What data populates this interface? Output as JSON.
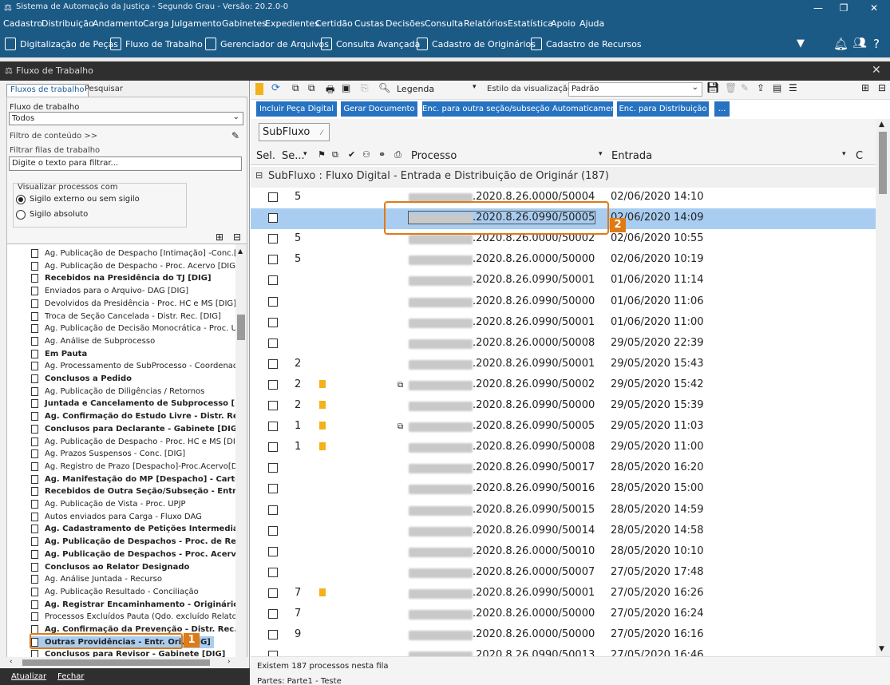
{
  "app": {
    "title": "Sistema de Automação da Justiça - Segundo Grau - Versão: 20.2.0-0",
    "min_icon": "—",
    "restore_icon": "❐",
    "close_icon": "✕"
  },
  "menu": [
    "Cadastro",
    "Distribuição",
    "Andamento",
    "Carga",
    "Julgamento",
    "Gabinetes",
    "Expedientes",
    "Certidão",
    "Custas",
    "Decisões",
    "Consulta",
    "Relatórios",
    "Estatística",
    "Apoio",
    "Ajuda"
  ],
  "toolbar": [
    "Digitalização de Peças",
    "Fluxo de Trabalho",
    "Gerenciador de Arquivos",
    "Consulta Avançada",
    "Cadastro de Originários",
    "Cadastro de Recursos"
  ],
  "panel": {
    "title": "Fluxo de Trabalho",
    "close": "✕"
  },
  "left": {
    "tabs": [
      "Fluxos de trabalho",
      "Pesquisar"
    ],
    "fluxo_label": "Fluxo de trabalho",
    "fluxo_value": "Todos",
    "filtro_conteudo": "Filtro de conteúdo >>",
    "filtrar_label": "Filtrar filas de trabalho",
    "filtrar_placeholder": "Digite o texto para filtrar...",
    "visualizar_label": "Visualizar processos com",
    "radio1": "Sigilo externo ou sem sigilo",
    "radio2": "Sigilo absoluto",
    "tree": [
      {
        "label": "Ag. Publicação de Despacho [Intimação] -Conc.[DIG]",
        "bold": false
      },
      {
        "label": "Ag. Publicação de Despacho - Proc. Acervo [DIG]",
        "bold": false
      },
      {
        "label": "Recebidos na Presidência do TJ [DIG]",
        "bold": true
      },
      {
        "label": "Enviados para o Arquivo- DAG [DIG]",
        "bold": false
      },
      {
        "label": "Devolvidos da Presidência - Proc. HC e MS [DIG]",
        "bold": false
      },
      {
        "label": "Troca de Seção Cancelada - Distr. Rec. [DIG]",
        "bold": false
      },
      {
        "label": "Ag. Publicação de Decisão Monocrática - Proc. UPJP",
        "bold": false
      },
      {
        "label": "Ag. Análise de Subprocesso",
        "bold": false
      },
      {
        "label": "Em Pauta",
        "bold": true
      },
      {
        "label": "Ag. Processamento de SubProcesso - Coordenadoria",
        "bold": false
      },
      {
        "label": "Conclusos a Pedido",
        "bold": true
      },
      {
        "label": "Ag. Publicação de Diligências / Retornos",
        "bold": false
      },
      {
        "label": "Juntada e Cancelamento de Subprocesso [DIG]",
        "bold": true
      },
      {
        "label": "Ag. Confirmação do Estudo Livre - Distr. Rec.[DIG]",
        "bold": true
      },
      {
        "label": "Conclusos para Declarante - Gabinete [DIG]",
        "bold": true
      },
      {
        "label": "Ag. Publicação de Despacho - Proc. HC e MS [DIG]",
        "bold": false
      },
      {
        "label": "Ag. Prazos Suspensos - Conc. [DIG]",
        "bold": false
      },
      {
        "label": "Ag. Registro de Prazo [Despacho]-Proc.Acervo[DIG]",
        "bold": false
      },
      {
        "label": "Ag. Manifestação do MP [Despacho] - Cartório [DIG",
        "bold": true
      },
      {
        "label": "Recebidos de Outra Seção/Subseção - Entr.Rec.[DIG]",
        "bold": true
      },
      {
        "label": "Ag. Publicação de Vista - Proc. UPJP",
        "bold": false
      },
      {
        "label": "Autos enviados para Carga - Fluxo DAG",
        "bold": false
      },
      {
        "label": "Ag. Cadastramento de Petições Intermediárias",
        "bold": true
      },
      {
        "label": "Ag. Publicação de Despachos - Proc. de Recurso",
        "bold": true
      },
      {
        "label": "Ag. Publicação de Despachos - Proc. Acervo",
        "bold": true
      },
      {
        "label": "Conclusos ao Relator Designado",
        "bold": true
      },
      {
        "label": "Ag. Análise Juntada - Recurso",
        "bold": false
      },
      {
        "label": "Ag. Publicação Resultado - Conciliação",
        "bold": false
      },
      {
        "label": "Ag. Registrar Encaminhamento - Originários",
        "bold": true
      },
      {
        "label": "Processos Excluídos Pauta (Qdo. excluído Relator)",
        "bold": false
      },
      {
        "label": "Ag. Confirmação da Prevenção - Distr. Rec. [DIG]",
        "bold": true
      },
      {
        "label": "Outras Providências - Entr. Ori. [DIG]",
        "bold": true
      },
      {
        "label": "Conclusos para Revisor - Gabinete [DIG]",
        "bold": true
      }
    ],
    "atualizar": "Atualizar",
    "fechar": "Fechar"
  },
  "right": {
    "legenda": "Legenda",
    "estilo_label": "Estilo da visualização",
    "estilo_value": "Padrão",
    "buttons": [
      "Incluir Peça Digital",
      "Gerar Documento",
      "Enc. para outra seção/subseção Automaticamente",
      "Enc. para Distribuição",
      "..."
    ],
    "subfluxo_chip": "SubFluxo",
    "columns": {
      "sel": "Sel.",
      "se": "Se...",
      "processo": "Processo",
      "entrada": "Entrada",
      "c": "C"
    },
    "group": "SubFluxo : Fluxo Digital - Entrada e Distribuição de Originár  (187)",
    "rows": [
      {
        "seq": "5",
        "flag": false,
        "attach": false,
        "proc": ".2020.8.26.0000/50004",
        "date": "02/06/2020 14:10"
      },
      {
        "seq": "",
        "flag": false,
        "attach": false,
        "proc": ".2020.8.26.0990/50005",
        "date": "02/06/2020 14:09"
      },
      {
        "seq": "5",
        "flag": false,
        "attach": false,
        "proc": ".2020.8.26.0000/50002",
        "date": "02/06/2020 10:55"
      },
      {
        "seq": "5",
        "flag": false,
        "attach": false,
        "proc": ".2020.8.26.0000/50000",
        "date": "02/06/2020 10:19"
      },
      {
        "seq": "",
        "flag": false,
        "attach": false,
        "proc": ".2020.8.26.0990/50001",
        "date": "01/06/2020 11:14"
      },
      {
        "seq": "",
        "flag": false,
        "attach": false,
        "proc": ".2020.8.26.0990/50000",
        "date": "01/06/2020 11:06"
      },
      {
        "seq": "",
        "flag": false,
        "attach": false,
        "proc": ".2020.8.26.0990/50001",
        "date": "01/06/2020 11:00"
      },
      {
        "seq": "",
        "flag": false,
        "attach": false,
        "proc": ".2020.8.26.0000/50008",
        "date": "29/05/2020 22:39"
      },
      {
        "seq": "2",
        "flag": false,
        "attach": false,
        "proc": ".2020.8.26.0990/50001",
        "date": "29/05/2020 15:43"
      },
      {
        "seq": "2",
        "flag": true,
        "attach": true,
        "proc": ".2020.8.26.0990/50002",
        "date": "29/05/2020 15:42"
      },
      {
        "seq": "2",
        "flag": true,
        "attach": false,
        "proc": ".2020.8.26.0990/50000",
        "date": "29/05/2020 15:39"
      },
      {
        "seq": "1",
        "flag": true,
        "attach": true,
        "proc": ".2020.8.26.0990/50005",
        "date": "29/05/2020 11:03"
      },
      {
        "seq": "1",
        "flag": true,
        "attach": false,
        "proc": ".2020.8.26.0990/50008",
        "date": "29/05/2020 11:00"
      },
      {
        "seq": "",
        "flag": false,
        "attach": false,
        "proc": ".2020.8.26.0990/50017",
        "date": "28/05/2020 16:20"
      },
      {
        "seq": "",
        "flag": false,
        "attach": false,
        "proc": ".2020.8.26.0990/50016",
        "date": "28/05/2020 15:00"
      },
      {
        "seq": "",
        "flag": false,
        "attach": false,
        "proc": ".2020.8.26.0990/50015",
        "date": "28/05/2020 14:59"
      },
      {
        "seq": "",
        "flag": false,
        "attach": false,
        "proc": ".2020.8.26.0990/50014",
        "date": "28/05/2020 14:58"
      },
      {
        "seq": "",
        "flag": false,
        "attach": false,
        "proc": ".2020.8.26.0000/50010",
        "date": "28/05/2020 10:10"
      },
      {
        "seq": "",
        "flag": false,
        "attach": false,
        "proc": ".2020.8.26.0000/50007",
        "date": "27/05/2020 17:48"
      },
      {
        "seq": "7",
        "flag": true,
        "attach": false,
        "proc": ".2020.8.26.0990/50001",
        "date": "27/05/2020 16:26"
      },
      {
        "seq": "7",
        "flag": false,
        "attach": false,
        "proc": ".2020.8.26.0000/50000",
        "date": "27/05/2020 16:24"
      },
      {
        "seq": "9",
        "flag": false,
        "attach": false,
        "proc": ".2020.8.26.0000/50000",
        "date": "27/05/2020 16:16"
      },
      {
        "seq": "",
        "flag": false,
        "attach": false,
        "proc": ".2020.8.26.0990/50013",
        "date": "27/05/2020 16:46"
      }
    ],
    "status": "Existem 187 processos nesta fila",
    "partes": "Partes: Parte1 - Teste"
  },
  "callouts": [
    "1",
    "2"
  ],
  "colors": {
    "chrome": "#1c5a86",
    "button": "#2773c2",
    "selected": "#a9cdf0",
    "callout": "#e07a17"
  }
}
